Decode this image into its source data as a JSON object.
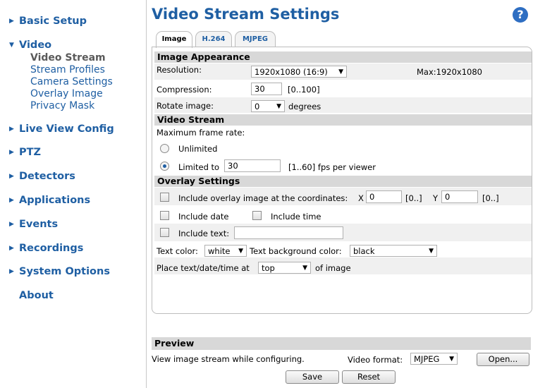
{
  "sidebar": {
    "basic_setup": "Basic Setup",
    "video": "Video",
    "video_items": [
      "Video Stream",
      "Stream Profiles",
      "Camera Settings",
      "Overlay Image",
      "Privacy Mask"
    ],
    "live_view_config": "Live View Config",
    "ptz": "PTZ",
    "detectors": "Detectors",
    "applications": "Applications",
    "events": "Events",
    "recordings": "Recordings",
    "system_options": "System Options",
    "about": "About"
  },
  "header": {
    "title": "Video Stream Settings",
    "help_icon": "?"
  },
  "tabs": [
    "Image",
    "H.264",
    "MJPEG"
  ],
  "image_appearance": {
    "heading": "Image Appearance",
    "resolution_label": "Resolution:",
    "resolution_value": "1920x1080 (16:9)",
    "max_resolution": "Max:1920x1080",
    "compression_label": "Compression:",
    "compression_value": "30",
    "compression_range": "[0..100]",
    "rotate_label": "Rotate image:",
    "rotate_value": "0",
    "rotate_unit": "degrees"
  },
  "video_stream": {
    "heading": "Video Stream",
    "max_frame_rate_label": "Maximum frame rate:",
    "unlimited_label": "Unlimited",
    "limited_label": "Limited to",
    "limited_value": "30",
    "limited_range": "[1..60] fps per viewer",
    "selected": "limited"
  },
  "overlay": {
    "heading": "Overlay Settings",
    "include_overlay_label": "Include overlay image at the coordinates:",
    "x_label": "X",
    "x_value": "0",
    "x_range": "[0..]",
    "y_label": "Y",
    "y_value": "0",
    "y_range": "[0..]",
    "include_date_label": "Include date",
    "include_time_label": "Include time",
    "include_text_label": "Include text:",
    "include_text_value": "",
    "text_color_label": "Text color:",
    "text_color_value": "white",
    "text_bg_label": "Text background color:",
    "text_bg_value": "black",
    "place_label": "Place text/date/time at",
    "place_value": "top",
    "place_suffix": "of image"
  },
  "preview": {
    "heading": "Preview",
    "description": "View image stream while configuring.",
    "format_label": "Video format:",
    "format_value": "MJPEG",
    "open_button": "Open..."
  },
  "footer": {
    "save_button": "Save",
    "reset_button": "Reset"
  },
  "colors": {
    "link": "#1f5fa3",
    "section_header": "#d8d8d8",
    "help": "#2e6ec2"
  }
}
